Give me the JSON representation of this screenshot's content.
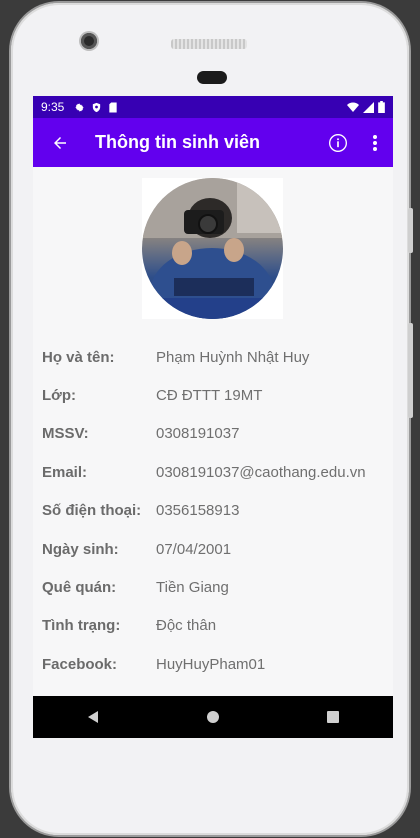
{
  "status_bar": {
    "time": "9:35"
  },
  "app_bar": {
    "title": "Thông tin sinh viên"
  },
  "profile": {
    "fields": [
      {
        "label": "Họ và tên:",
        "value": "Phạm Huỳnh Nhật Huy"
      },
      {
        "label": "Lớp:",
        "value": "CĐ ĐTTT 19MT"
      },
      {
        "label": "MSSV:",
        "value": "0308191037"
      },
      {
        "label": "Email:",
        "value": "0308191037@caothang.edu.vn"
      },
      {
        "label": "Số điện thoại:",
        "value": "0356158913"
      },
      {
        "label": "Ngày sinh:",
        "value": "07/04/2001"
      },
      {
        "label": "Quê quán:",
        "value": "Tiền Giang"
      },
      {
        "label": "Tình trạng:",
        "value": "Độc thân"
      },
      {
        "label": "Facebook:",
        "value": "HuyHuyPham01"
      }
    ]
  },
  "colors": {
    "status_bar": "#3700b3",
    "app_bar": "#6200ee",
    "nav_bar": "#000000"
  },
  "icons": [
    "settings-icon",
    "shield-icon",
    "sd-card-icon",
    "wifi-icon",
    "signal-icon",
    "battery-icon",
    "back-arrow-icon",
    "info-icon",
    "more-vert-icon",
    "nav-back-icon",
    "nav-home-icon",
    "nav-recents-icon"
  ]
}
